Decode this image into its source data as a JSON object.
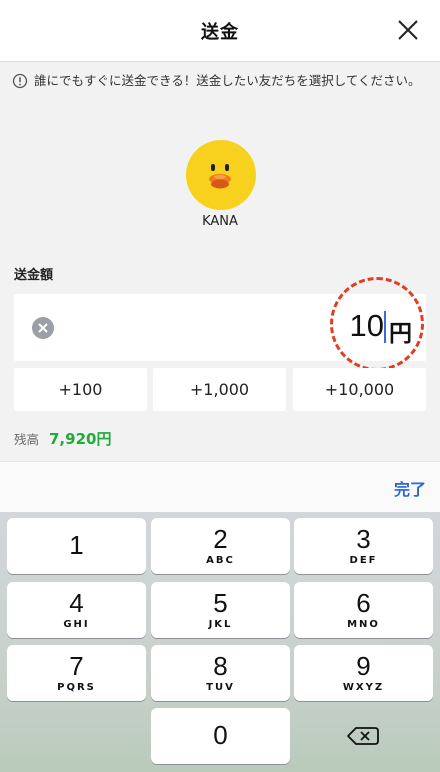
{
  "header": {
    "title": "送金",
    "close_icon": "close-icon"
  },
  "notice": {
    "icon": "info-circle-icon",
    "text": "誰にでもすぐに送金できる！送金したい友だちを選択してください。"
  },
  "recipient": {
    "name": "KANA",
    "avatar_icon": "duck-avatar-icon",
    "avatar_color": "#f7d11e"
  },
  "amount": {
    "label": "送金額",
    "value": "10",
    "currency": "円",
    "clear_icon": "clear-x-icon"
  },
  "quick_add": [
    "+100",
    "+1,000",
    "+10,000"
  ],
  "balance": {
    "label": "残高",
    "amount": "7,920円",
    "color": "#1faa3a"
  },
  "toolbar": {
    "done_label": "完了",
    "accent": "#2a64d6"
  },
  "keypad": {
    "keys": [
      {
        "num": "1",
        "letters": ""
      },
      {
        "num": "2",
        "letters": "ABC"
      },
      {
        "num": "3",
        "letters": "DEF"
      },
      {
        "num": "4",
        "letters": "GHI"
      },
      {
        "num": "5",
        "letters": "JKL"
      },
      {
        "num": "6",
        "letters": "MNO"
      },
      {
        "num": "7",
        "letters": "PQRS"
      },
      {
        "num": "8",
        "letters": "TUV"
      },
      {
        "num": "9",
        "letters": "WXYZ"
      },
      {
        "num": "0",
        "letters": ""
      }
    ],
    "backspace_icon": "backspace-icon"
  },
  "highlight_color": "#e23c21"
}
